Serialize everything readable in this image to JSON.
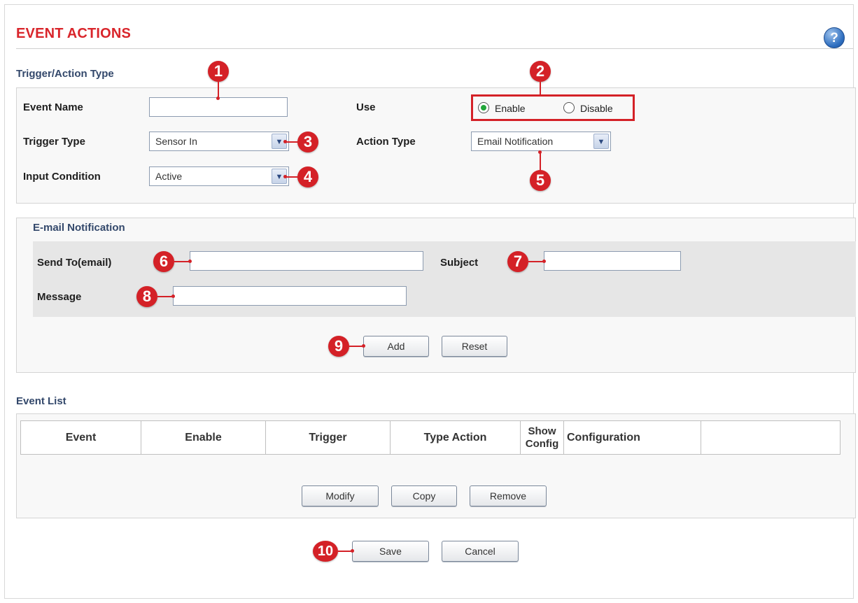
{
  "page": {
    "title": "EVENT ACTIONS",
    "help_icon_glyph": "?",
    "help_icon": "help-icon"
  },
  "trigger_section": {
    "title": "Trigger/Action Type",
    "event_name_label": "Event Name",
    "event_name_value": "",
    "use_label": "Use",
    "use_options": [
      "Enable",
      "Disable"
    ],
    "use_selected": "Enable",
    "trigger_type_label": "Trigger Type",
    "trigger_type_value": "Sensor In",
    "action_type_label": "Action Type",
    "action_type_value": "Email Notification",
    "input_condition_label": "Input Condition",
    "input_condition_value": "Active"
  },
  "email_section": {
    "title": "E-mail Notification",
    "send_to_label": "Send To(email)",
    "send_to_value": "",
    "subject_label": "Subject",
    "subject_value": "",
    "message_label": "Message",
    "message_value": "",
    "add_label": "Add",
    "reset_label": "Reset"
  },
  "event_list": {
    "title": "Event List",
    "columns": [
      "Event",
      "Enable",
      "Trigger",
      "Type Action",
      "Show Config",
      "Configuration",
      ""
    ],
    "rows": [],
    "modify_label": "Modify",
    "copy_label": "Copy",
    "remove_label": "Remove"
  },
  "footer": {
    "save_label": "Save",
    "cancel_label": "Cancel"
  },
  "markers": [
    "1",
    "2",
    "3",
    "4",
    "5",
    "6",
    "7",
    "8",
    "9",
    "10"
  ],
  "colors": {
    "title_red": "#d9252b",
    "marker_red": "#d42127",
    "section_blue": "#33486b",
    "radio_green": "#22a63a"
  }
}
